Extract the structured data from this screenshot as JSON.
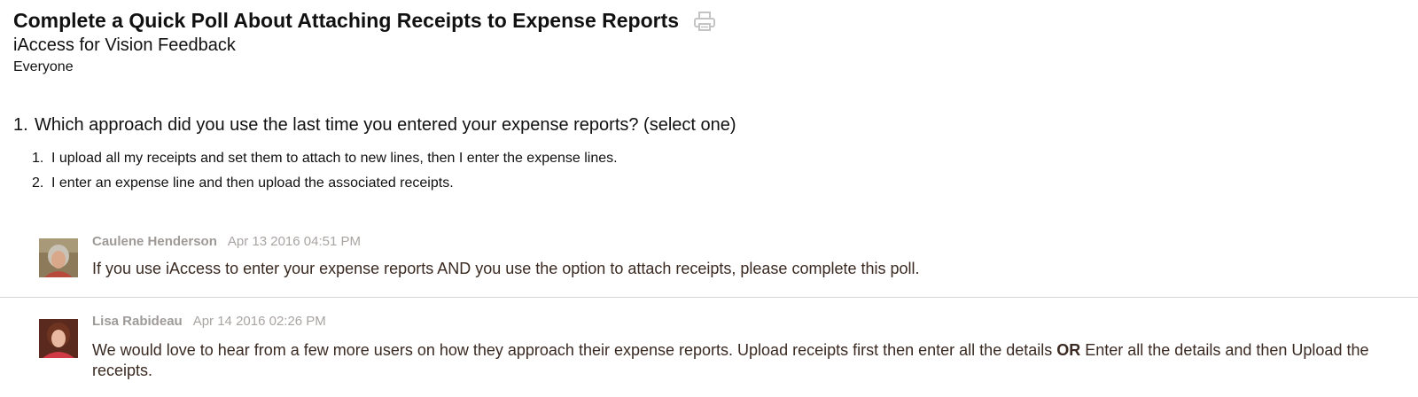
{
  "header": {
    "title": "Complete a Quick Poll About Attaching Receipts to Expense Reports",
    "print_icon": "printer-icon",
    "group": "iAccess for Vision Feedback",
    "audience": "Everyone"
  },
  "poll": {
    "question_number": "1.",
    "question": "Which approach did you use the last time you entered your expense reports? (select one)",
    "options": [
      {
        "number": "1.",
        "text": "I upload all my receipts and set them to attach to new lines, then I enter the expense lines."
      },
      {
        "number": "2.",
        "text": "I enter an expense line and then upload the associated receipts."
      }
    ]
  },
  "comments": [
    {
      "author": "Caulene Henderson",
      "date": "Apr 13 2016 04:51 PM",
      "text": "If you use iAccess to enter your expense reports AND you use the option to attach receipts, please complete this poll."
    },
    {
      "author": "Lisa Rabideau",
      "date": "Apr 14 2016 02:26 PM",
      "text_part1": "We would love to hear from a few more users on how they approach their expense reports.  Upload receipts first then enter all the details ",
      "text_bold": "OR",
      "text_part2": " Enter all the details and then Upload the receipts."
    }
  ],
  "colors": {
    "meta": "#9e9a98",
    "comment_text": "#3a2a22",
    "divider": "#d6d6d6"
  }
}
